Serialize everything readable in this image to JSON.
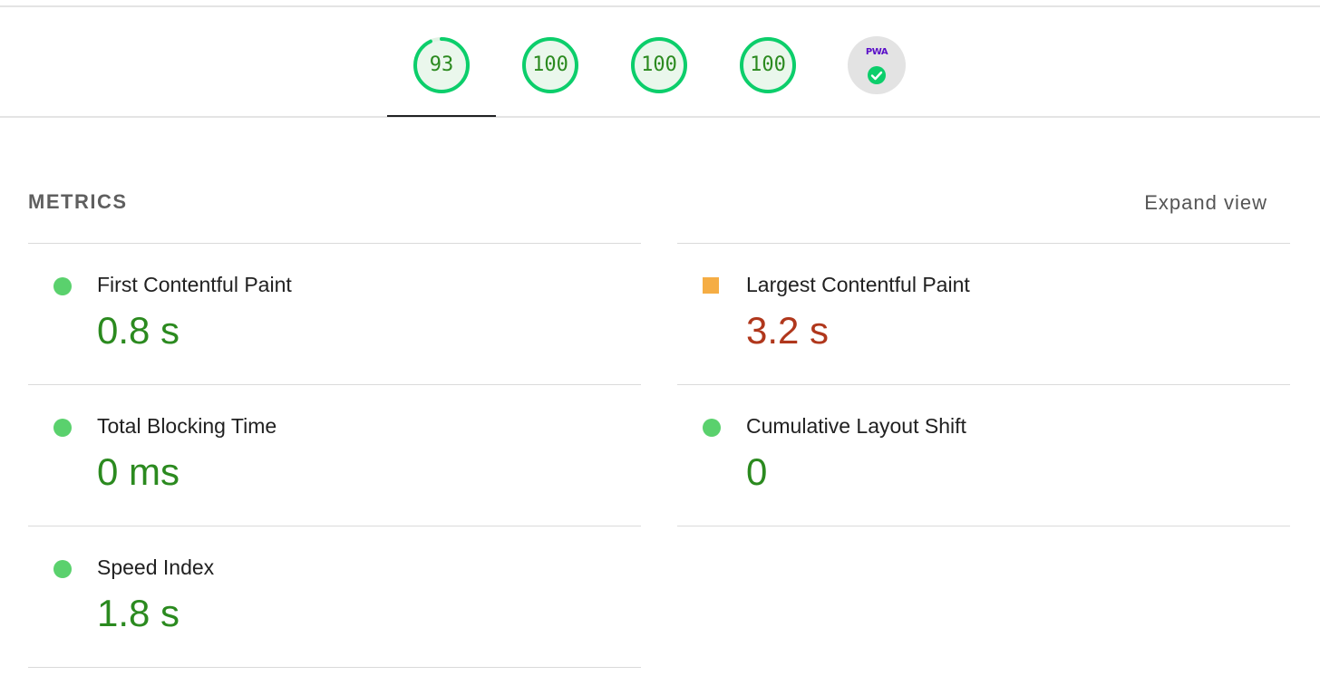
{
  "colors": {
    "pass_green": "#0cce6b",
    "pass_text": "#2b8a1f",
    "average_orange": "#ffa400",
    "fail_text": "#b0371c",
    "gauge_track": "#e8f5e9"
  },
  "gauges": [
    {
      "score": "93",
      "fraction": 0.93
    },
    {
      "score": "100",
      "fraction": 1.0
    },
    {
      "score": "100",
      "fraction": 1.0
    },
    {
      "score": "100",
      "fraction": 1.0
    }
  ],
  "pwa": {
    "label": "PWA",
    "icon": "check-circle-icon"
  },
  "metrics_header": {
    "title": "METRICS",
    "expand_label": "Expand view"
  },
  "metrics": {
    "fcp": {
      "label": "First Contentful Paint",
      "value": "0.8 s",
      "status": "pass"
    },
    "lcp": {
      "label": "Largest Contentful Paint",
      "value": "3.2 s",
      "status": "average"
    },
    "tbt": {
      "label": "Total Blocking Time",
      "value": "0 ms",
      "status": "pass"
    },
    "cls": {
      "label": "Cumulative Layout Shift",
      "value": "0",
      "status": "pass"
    },
    "si": {
      "label": "Speed Index",
      "value": "1.8 s",
      "status": "pass"
    }
  }
}
